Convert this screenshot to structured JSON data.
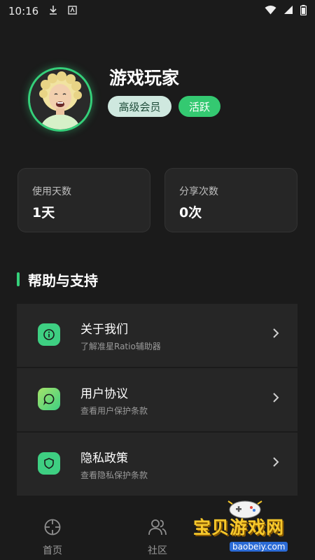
{
  "status_bar": {
    "time": "10:16"
  },
  "profile": {
    "username": "游戏玩家",
    "badges": [
      "高级会员",
      "活跃"
    ]
  },
  "stats": [
    {
      "label": "使用天数",
      "value": "1天"
    },
    {
      "label": "分享次数",
      "value": "0次"
    }
  ],
  "section": {
    "title": "帮助与支持"
  },
  "menu": [
    {
      "title": "关于我们",
      "subtitle": "了解准星Ratio辅助器",
      "icon": "info-icon"
    },
    {
      "title": "用户协议",
      "subtitle": "查看用户保护条款",
      "icon": "chat-bubble-icon"
    },
    {
      "title": "隐私政策",
      "subtitle": "查看隐私保护条款",
      "icon": "shield-icon"
    }
  ],
  "nav": [
    {
      "label": "首页",
      "icon": "crosshair-icon"
    },
    {
      "label": "社区",
      "icon": "users-icon"
    }
  ],
  "watermark": {
    "main": "宝贝游戏网",
    "url": "baobeiy.com"
  },
  "colors": {
    "accent": "#35d07a",
    "background": "#1b1b1b",
    "card": "#262626"
  }
}
